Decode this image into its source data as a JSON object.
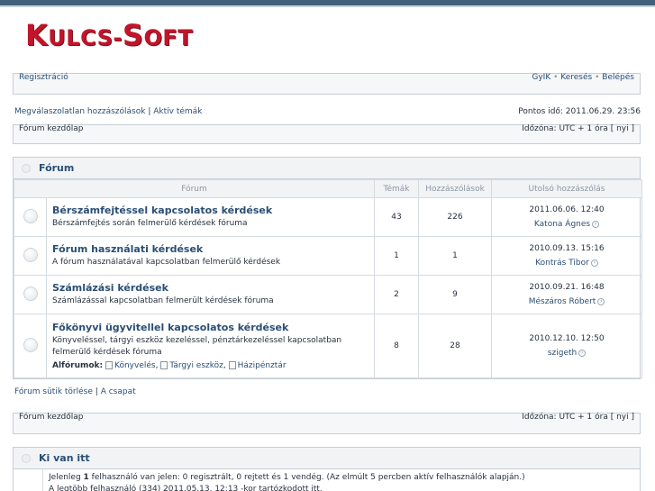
{
  "logo": {
    "first_big": "K",
    "first_small": "ULCS",
    "dash": "-",
    "second_big": "S",
    "second_small": "OFT"
  },
  "navbar": {
    "register": "Regisztráció",
    "faq": "GyIK",
    "search": "Keresés",
    "login": "Belépés",
    "bullet": "•"
  },
  "quicklinks": {
    "unanswered": "Megválaszolatlan hozzászólások",
    "divider": "|",
    "active": "Aktív témák",
    "current_time": "Pontos idő: 2011.06.29. 23:56"
  },
  "breadcrumb": {
    "home": "Fórum kezdőlap",
    "timezone": "Időzóna: UTC + 1 óra [ nyi ]"
  },
  "forum_section": {
    "title": "Fórum",
    "columns": {
      "forum": "Fórum",
      "topics": "Témák",
      "posts": "Hozzászólások",
      "last_post": "Utolsó hozzászólás"
    },
    "rows": [
      {
        "name": "Bérszámfejtéssel kapcsolatos kérdések",
        "desc": "Bérszámfejtés során felmerülő kérdések fóruma",
        "topics": "43",
        "posts": "226",
        "date": "2011.06.06. 12:40",
        "user": "Katona Ágnes"
      },
      {
        "name": "Fórum használati kérdések",
        "desc": "A fórum használatával kapcsolatban felmerülő kérdések",
        "topics": "1",
        "posts": "1",
        "date": "2010.09.13. 15:16",
        "user": "Kontrás Tibor"
      },
      {
        "name": "Számlázási kérdések",
        "desc": "Számlázással kapcsolatban felmerült kérdések fóruma",
        "topics": "2",
        "posts": "9",
        "date": "2010.09.21. 16:48",
        "user": "Mészáros Róbert"
      },
      {
        "name": "Főkönyvi ügyvitellel kapcsolatos kérdések",
        "desc": "Könyveléssel, tárgyi eszköz kezeléssel, pénztárkezeléssel kapcsolatban felmerülő kérdések fóruma",
        "topics": "8",
        "posts": "28",
        "date": "2010.12.10. 12:50",
        "user": "szigeth",
        "subforums_label": "Alfórumok:",
        "subforums": [
          "Könyvelés",
          "Tárgyi eszköz",
          "Házipénztár"
        ]
      }
    ]
  },
  "footer_links": {
    "delete_cookies": "Fórum sütik törlése",
    "divider": "|",
    "team": "A csapat"
  },
  "breadcrumb2": {
    "home": "Fórum kezdőlap",
    "timezone": "Időzóna: UTC + 1 óra [ nyi ]"
  },
  "whoisonline": {
    "title": "Ki van itt",
    "line1_pre": "Jelenleg ",
    "line1_count": "1",
    "line1_post": " felhasználó van jelen: 0 regisztrált, 0 rejtett és 1 vendég. (Az elmúlt 5 percben aktív felhasználók alapján.)",
    "line2": "A legtöbb felhasználó (334) 2011.05.13. 12:13 -kor tartózkodott itt."
  }
}
